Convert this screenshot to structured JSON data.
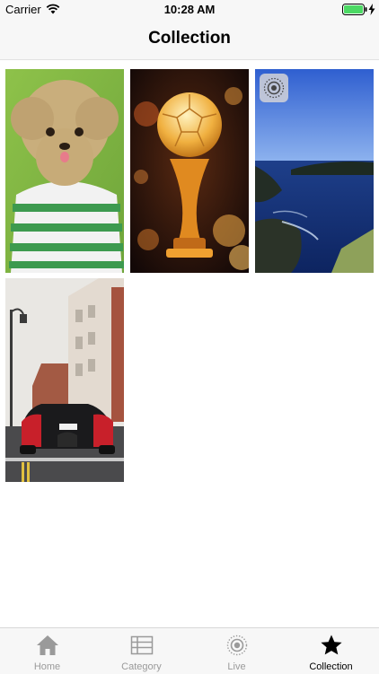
{
  "status_bar": {
    "carrier": "Carrier",
    "time": "10:28 AM"
  },
  "nav": {
    "title": "Collection"
  },
  "grid": {
    "items": [
      {
        "name": "photo-poodle",
        "live": false
      },
      {
        "name": "photo-football-trophy",
        "live": false
      },
      {
        "name": "photo-coastline",
        "live": true
      },
      {
        "name": "photo-sports-car",
        "live": false
      }
    ]
  },
  "tabs": [
    {
      "label": "Home",
      "icon": "home-icon",
      "active": false
    },
    {
      "label": "Category",
      "icon": "category-icon",
      "active": false
    },
    {
      "label": "Live",
      "icon": "live-icon",
      "active": false
    },
    {
      "label": "Collection",
      "icon": "star-icon",
      "active": true
    }
  ],
  "colors": {
    "active_tab": "#000000",
    "inactive_tab": "#9a9a9a",
    "bar_bg": "#f7f7f7",
    "battery": "#4cd964"
  }
}
